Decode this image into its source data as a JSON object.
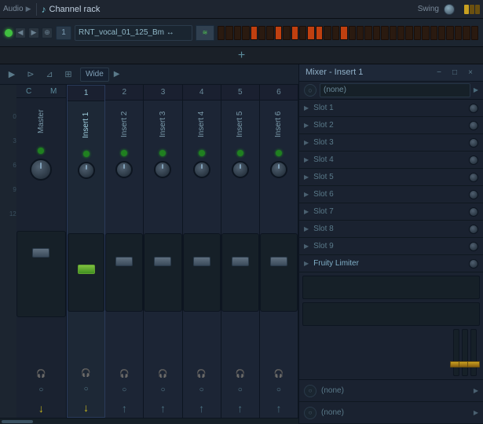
{
  "topbar": {
    "audio_label": "Audio",
    "channel_rack_label": "Channel rack",
    "swing_label": "Swing",
    "cr_icon": "♪"
  },
  "cr_row": {
    "led_on": true,
    "track_num": "1",
    "track_name": "RNT_vocal_01_125_Bm ↔",
    "steps": [
      0,
      0,
      0,
      0,
      1,
      0,
      0,
      1,
      0,
      1,
      0,
      1,
      1,
      0,
      0,
      1,
      0,
      0,
      0,
      0,
      0,
      0,
      0,
      0,
      0,
      0,
      0,
      0,
      0,
      0,
      0,
      0
    ]
  },
  "mixer": {
    "title": "Mixer - Insert 1",
    "wide_label": "Wide",
    "db_labels": [
      "0",
      "3",
      "6",
      "9",
      "12"
    ],
    "tracks": [
      {
        "label": "C M",
        "name": "Master",
        "num": "",
        "is_master": true
      },
      {
        "label": "1",
        "name": "Insert 1",
        "num": "1",
        "active": true
      },
      {
        "label": "2",
        "name": "Insert 2",
        "num": "2"
      },
      {
        "label": "3",
        "name": "Insert 3",
        "num": "3"
      },
      {
        "label": "4",
        "name": "Insert 4",
        "num": "4"
      },
      {
        "label": "5",
        "name": "Insert 5",
        "num": "5"
      },
      {
        "label": "6",
        "name": "Insert 6",
        "num": "6"
      }
    ]
  },
  "insert_panel": {
    "title": "Mixer - Insert 1",
    "dropdown_value": "(none)",
    "slots": [
      {
        "label": "Slot 1",
        "plugin": false
      },
      {
        "label": "Slot 2",
        "plugin": false
      },
      {
        "label": "Slot 3",
        "plugin": false
      },
      {
        "label": "Slot 4",
        "plugin": false
      },
      {
        "label": "Slot 5",
        "plugin": false
      },
      {
        "label": "Slot 6",
        "plugin": false
      },
      {
        "label": "Slot 7",
        "plugin": false
      },
      {
        "label": "Slot 8",
        "plugin": false
      },
      {
        "label": "Slot 9",
        "plugin": false
      },
      {
        "label": "Fruity Limiter",
        "plugin": true
      }
    ],
    "bottom_slots": [
      {
        "label": "(none)"
      },
      {
        "label": "(none)"
      }
    ]
  }
}
